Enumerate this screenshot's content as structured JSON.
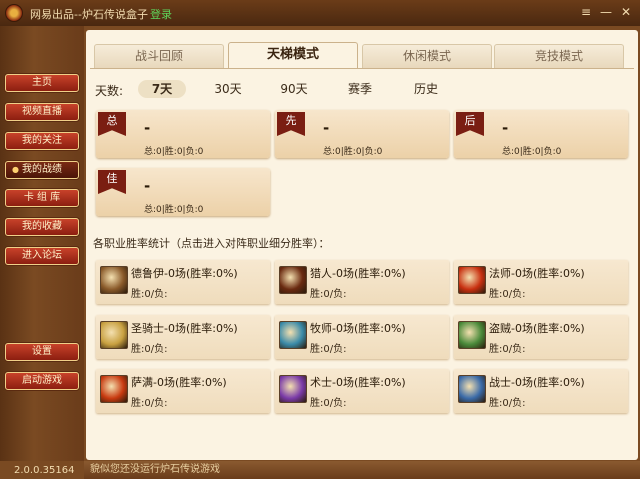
{
  "window": {
    "title": "网易出品--炉石传说盒子",
    "login": "登录",
    "settings_glyph": "≡",
    "minimize_glyph": "—",
    "close_glyph": "✕"
  },
  "sidebar": {
    "items": [
      {
        "label": "主页"
      },
      {
        "label": "视频直播"
      },
      {
        "label": "我的关注"
      },
      {
        "label": "我的战绩",
        "active": true
      },
      {
        "label": "卡 组 库"
      },
      {
        "label": "我的收藏"
      },
      {
        "label": "进入论坛"
      },
      {
        "label": "设置"
      },
      {
        "label": "启动游戏"
      }
    ],
    "bullet": "●"
  },
  "version": "2.0.0.35164",
  "status": "貌似您还没运行炉石传说游戏",
  "tabs": [
    {
      "label": "战斗回顾"
    },
    {
      "label": "天梯模式",
      "active": true
    },
    {
      "label": "休闲模式"
    },
    {
      "label": "竞技模式"
    }
  ],
  "days": {
    "label": "天数:",
    "options": [
      "7天",
      "30天",
      "90天",
      "赛季",
      "历史"
    ],
    "selected": "7天"
  },
  "summary": [
    {
      "flag": "总",
      "value": "-",
      "stats": "总:0|胜:0|负:0"
    },
    {
      "flag": "先",
      "value": "-",
      "stats": "总:0|胜:0|负:0"
    },
    {
      "flag": "后",
      "value": "-",
      "stats": "总:0|胜:0|负:0"
    },
    {
      "flag": "佳",
      "value": "-",
      "stats": "总:0|胜:0|负:0"
    }
  ],
  "section_title": "各职业胜率统计（点击进入对阵职业细分胜率）：",
  "classes": [
    {
      "name": "德鲁伊-0场(胜率:0%)",
      "stats": "胜:0/负:",
      "color": "#8a5a2a"
    },
    {
      "name": "猎人-0场(胜率:0%)",
      "stats": "胜:0/负:",
      "color": "#6a2a10"
    },
    {
      "name": "法师-0场(胜率:0%)",
      "stats": "胜:0/负:",
      "color": "#c83010"
    },
    {
      "name": "圣骑士-0场(胜率:0%)",
      "stats": "胜:0/负:",
      "color": "#c8a040"
    },
    {
      "name": "牧师-0场(胜率:0%)",
      "stats": "胜:0/负:",
      "color": "#3a8aa8"
    },
    {
      "name": "盗贼-0场(胜率:0%)",
      "stats": "胜:0/负:",
      "color": "#4a8a3a"
    },
    {
      "name": "萨满-0场(胜率:0%)",
      "stats": "胜:0/负:",
      "color": "#c83a10"
    },
    {
      "name": "术士-0场(胜率:0%)",
      "stats": "胜:0/负:",
      "color": "#7a3aa8"
    },
    {
      "name": "战士-0场(胜率:0%)",
      "stats": "胜:0/负:",
      "color": "#3a6aa8"
    }
  ]
}
